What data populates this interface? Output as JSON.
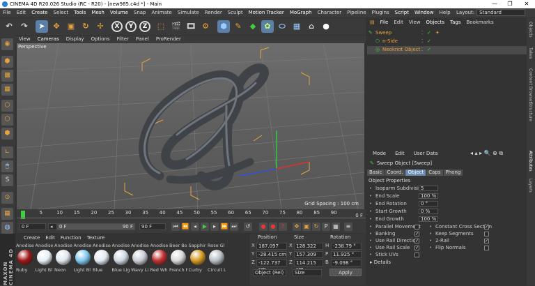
{
  "window": {
    "title": "CINEMA 4D R20.026 Studio (RC - R20) - [new985.c4d *] - Main",
    "min": "—",
    "max": "❐",
    "close": "✕"
  },
  "menu": [
    "File",
    "Edit",
    "Create",
    "Select",
    "Tools",
    "Mesh",
    "Volume",
    "Snap",
    "Animate",
    "Simulate",
    "Render",
    "Sculpt",
    "Motion Tracker",
    "MoGraph",
    "Character",
    "Pipeline",
    "Plugins",
    "Script",
    "Window",
    "Help"
  ],
  "layout": {
    "label": "Layout:",
    "value": "Standard"
  },
  "toolbar": {
    "x": "X",
    "y": "Y",
    "z": "Z"
  },
  "viewport": {
    "menu": [
      "View",
      "Cameras",
      "Display",
      "Options",
      "Filter",
      "Panel",
      "ProRender"
    ],
    "label": "Perspective",
    "grid_spacing": "Grid Spacing : 100 cm"
  },
  "timeline": {
    "ticks": [
      "0",
      "5",
      "10",
      "15",
      "20",
      "25",
      "30",
      "35",
      "40",
      "45",
      "50",
      "55",
      "60",
      "65",
      "70",
      "75",
      "80",
      "85",
      "90"
    ],
    "end_label": "0 F",
    "start_field": "0 F",
    "min_field": "0 F",
    "max_field": "90 F",
    "end_field": "90 F"
  },
  "materials": {
    "menu": [
      "Create",
      "Edit",
      "Function",
      "Texture"
    ],
    "items": [
      {
        "header": "Anodise",
        "name": "Ruby",
        "color": "#a01818"
      },
      {
        "header": "Anodise",
        "name": "Light Bl",
        "color": "#e8eef5"
      },
      {
        "header": "Anodise",
        "name": "Neon",
        "color": "#dfe6ee"
      },
      {
        "header": "Anodise",
        "name": "Light Bl",
        "color": "#7fc8ee"
      },
      {
        "header": "Anodise",
        "name": "Blue",
        "color": "#e2e8f0"
      },
      {
        "header": "Anodise",
        "name": "Blue Lig",
        "color": "#cfd8e2"
      },
      {
        "header": "Anodise",
        "name": "Wavy Li",
        "color": "#c9ced6"
      },
      {
        "header": "Anodise",
        "name": "Red Wh",
        "color": "#c03030"
      },
      {
        "header": "Beer Bo",
        "name": "French F",
        "color": "#d8d8d8"
      },
      {
        "header": "Sapphir",
        "name": "Curby",
        "color": "#d49a20"
      },
      {
        "header": "Rose Gl",
        "name": "Circuit L",
        "color": "#b8bec6"
      }
    ]
  },
  "coords": {
    "headers": [
      "Position",
      "Size",
      "Rotation"
    ],
    "rows": [
      {
        "axis": "X",
        "pos": "187.097 cm",
        "size_axis": "X",
        "size": "128.322 cm",
        "rot_axis": "H",
        "rot": "-238.79 °"
      },
      {
        "axis": "Y",
        "pos": "-28.415 cm",
        "size_axis": "Y",
        "size": "157.309 cm",
        "rot_axis": "P",
        "rot": "11.925 °"
      },
      {
        "axis": "Z",
        "pos": "-122.737 cm",
        "size_axis": "Z",
        "size": "114.215 cm",
        "rot_axis": "B",
        "rot": "-9.098 °"
      }
    ],
    "mode": "Object (Rel)",
    "size_mode": "Size",
    "apply": "Apply"
  },
  "objects": {
    "menu": [
      "File",
      "Edit",
      "View",
      "Objects",
      "Tags",
      "Bookmarks"
    ],
    "items": [
      {
        "name": "Sweep",
        "color": "#e8a33a"
      },
      {
        "name": "n-Side",
        "color": "#e8a33a"
      },
      {
        "name": "Neoknot Object",
        "color": "#e8a33a"
      }
    ]
  },
  "attributes": {
    "menu": [
      "Mode",
      "Edit",
      "User Data"
    ],
    "object_title": "Sweep Object [Sweep]",
    "tabs": [
      "Basic",
      "Coord.",
      "Object",
      "Caps",
      "Phong"
    ],
    "active_tab": "Object",
    "section": "Object Properties",
    "props": [
      {
        "label": "Isoparm Subdivision",
        "value": "5"
      },
      {
        "label": "End Scale",
        "value": "100 %"
      },
      {
        "label": "End Rotation",
        "value": "0 °"
      },
      {
        "label": "Start Growth",
        "value": "0 %"
      },
      {
        "label": "End Growth",
        "value": "100 %"
      }
    ],
    "checks_left": [
      {
        "label": "Parallel Movement",
        "checked": false
      },
      {
        "label": "Banking",
        "checked": true
      },
      {
        "label": "Use Rail Direction",
        "checked": true
      },
      {
        "label": "Use Rail Scale",
        "checked": true
      },
      {
        "label": "Stick UVs",
        "checked": false
      }
    ],
    "checks_right": [
      {
        "label": "Constant Cross Section",
        "checked": true
      },
      {
        "label": "Keep Segments",
        "checked": false
      },
      {
        "label": "2-Rail",
        "checked": true
      },
      {
        "label": "Flip Normals",
        "checked": false
      }
    ],
    "details": "Details"
  },
  "rightbar": [
    "Objects",
    "Takes",
    "Content Browser",
    "Structure",
    "Attributes",
    "Layers"
  ]
}
